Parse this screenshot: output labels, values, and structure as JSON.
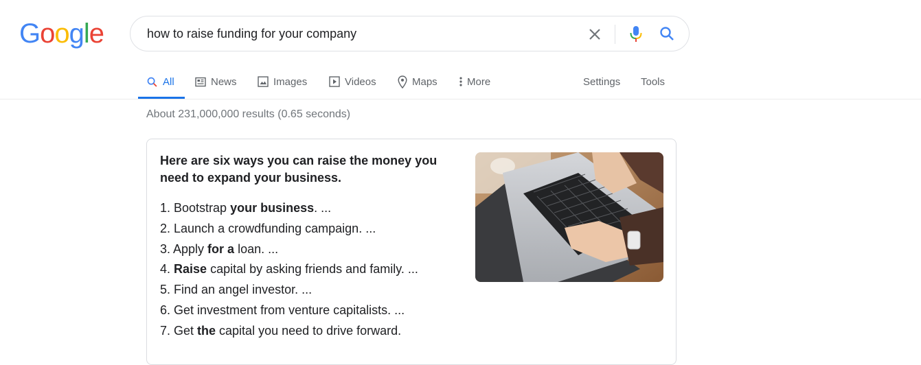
{
  "logo": {
    "letters": [
      "G",
      "o",
      "o",
      "g",
      "l",
      "e"
    ],
    "colors": [
      "#4285F4",
      "#EA4335",
      "#FBBC05",
      "#4285F4",
      "#34A853",
      "#EA4335"
    ]
  },
  "search": {
    "query": "how to raise funding for your company"
  },
  "tabs": [
    {
      "label": "All",
      "icon": "search-icon"
    },
    {
      "label": "News",
      "icon": "news-icon"
    },
    {
      "label": "Images",
      "icon": "image-icon"
    },
    {
      "label": "Videos",
      "icon": "video-icon"
    },
    {
      "label": "Maps",
      "icon": "map-pin-icon"
    },
    {
      "label": "More",
      "icon": "more-vert-icon"
    }
  ],
  "tools": {
    "settings": "Settings",
    "tools": "Tools"
  },
  "stats": "About 231,000,000 results (0.65 seconds)",
  "snippet": {
    "heading": "Here are six ways you can raise the money you need to expand your business.",
    "steps": [
      [
        {
          "t": "1. Bootstrap "
        },
        {
          "t": "your business",
          "b": true
        },
        {
          "t": ". ..."
        }
      ],
      [
        {
          "t": "2. Launch a crowdfunding campaign. ..."
        }
      ],
      [
        {
          "t": "3. Apply "
        },
        {
          "t": "for a",
          "b": true
        },
        {
          "t": " loan. ..."
        }
      ],
      [
        {
          "t": "4. "
        },
        {
          "t": "Raise",
          "b": true
        },
        {
          "t": " capital by asking friends and family. ..."
        }
      ],
      [
        {
          "t": "5. Find an angel investor. ..."
        }
      ],
      [
        {
          "t": "6. Get investment from venture capitalists. ..."
        }
      ],
      [
        {
          "t": "7. Get "
        },
        {
          "t": "the",
          "b": true
        },
        {
          "t": " capital you need to drive forward."
        }
      ]
    ]
  },
  "colors": {
    "accent": "#1a73e8",
    "muted": "#70757a",
    "tab_text": "#5f6368"
  }
}
